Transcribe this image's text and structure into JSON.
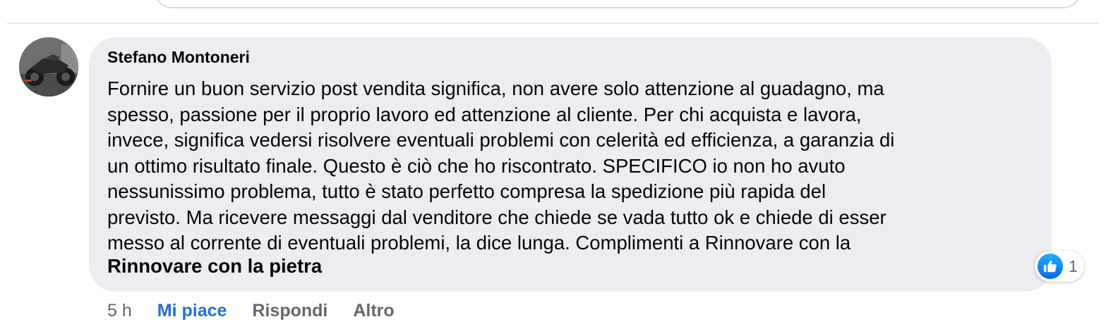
{
  "comment": {
    "author": "Stefano Montoneri",
    "text_lines": [
      "Fornire un buon servizio post vendita significa, non avere solo attenzione al guadagno, ma",
      "spesso, passione per il proprio lavoro ed attenzione al cliente. Per chi acquista e lavora,",
      "invece, significa vedersi risolvere eventuali problemi con celerità ed efficienza, a garanzia di",
      "un ottimo risultato finale. Questo è ciò che ho riscontrato. SPECIFICO io non ho avuto",
      "nessunissimo problema, tutto è stato perfetto compresa la spedizione più rapida del",
      "previsto. Ma ricevere messaggi dal venditore che chiede se vada tutto ok e chiede di esser",
      "messo al corrente di eventuali problemi, la dice lunga. Complimenti a Rinnovare con la"
    ],
    "tagged_page": "Rinnovare con la pietra",
    "reactions": {
      "icon": "like-icon",
      "count": "1",
      "color": "#0866ff"
    },
    "timestamp": "5 h",
    "actions": {
      "like": "Mi piace",
      "reply": "Rispondi",
      "more": "Altro"
    }
  },
  "colors": {
    "bubble": "#ebedf0",
    "liked": "#216fdb",
    "secondary_text": "#65676b"
  }
}
